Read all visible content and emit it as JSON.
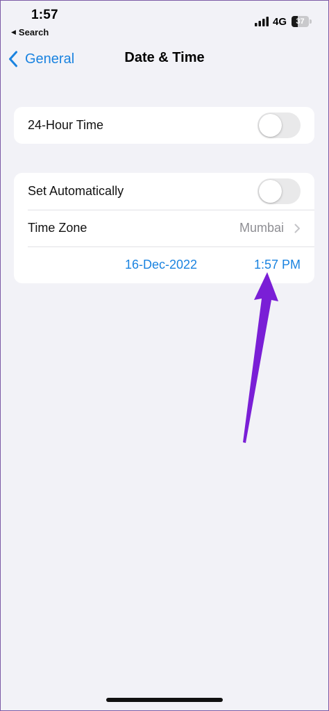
{
  "status_bar": {
    "time": "1:57",
    "back_to_app": "Search",
    "network": "4G",
    "battery": "37",
    "battery_level": 0.37
  },
  "nav": {
    "back_label": "General",
    "title": "Date & Time"
  },
  "settings": {
    "hour24": {
      "label": "24-Hour Time",
      "enabled": false
    },
    "set_automatically": {
      "label": "Set Automatically",
      "enabled": false
    },
    "time_zone": {
      "label": "Time Zone",
      "value": "Mumbai"
    },
    "date": "16-Dec-2022",
    "time": "1:57 PM"
  },
  "colors": {
    "accent": "#1a83e0",
    "background": "#f2f2f7",
    "annotation_arrow": "#7a1fd6"
  },
  "icons": {
    "back": "chevron-left-icon",
    "disclosure": "chevron-right-icon",
    "signal": "cellular-signal-icon",
    "battery": "battery-icon"
  }
}
